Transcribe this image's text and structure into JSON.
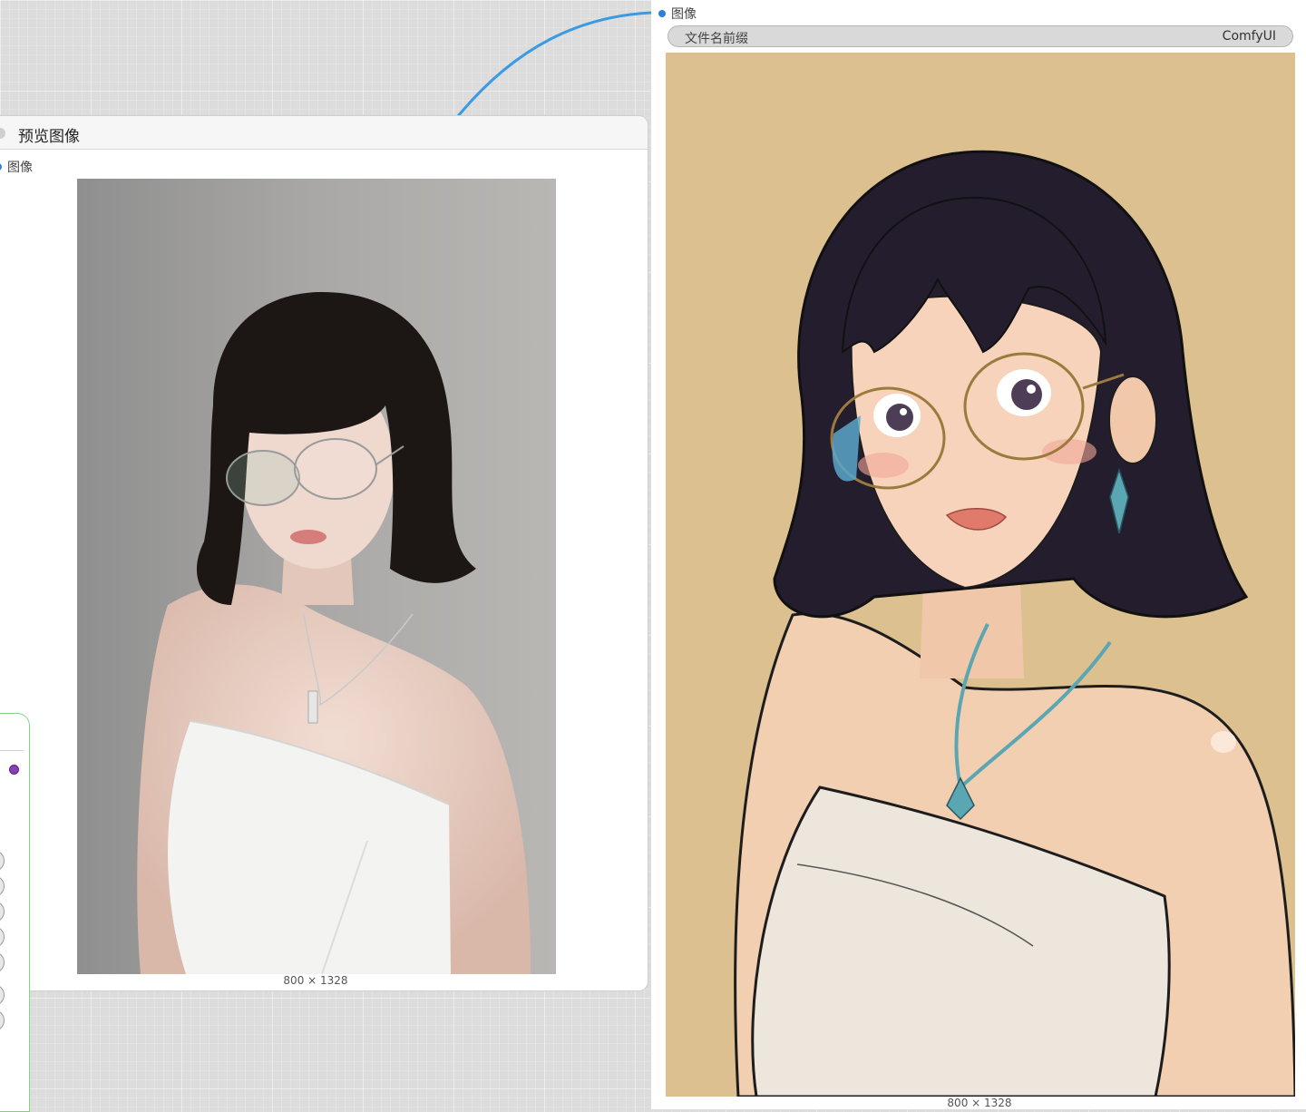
{
  "preview_node": {
    "title": "预览图像",
    "input_label": "图像",
    "image_dims": "800 × 1328"
  },
  "save_node": {
    "input_label": "图像",
    "prefix_label": "文件名前缀",
    "prefix_value": "ComfyUI",
    "image_dims": "800 × 1328"
  },
  "colors": {
    "wire": "#3b9ae1",
    "slot_image": "#2d7fd8",
    "slot_purple": "#8a3fb5",
    "side_border": "#7fd87f",
    "anime_bg": "#dcc08f"
  }
}
